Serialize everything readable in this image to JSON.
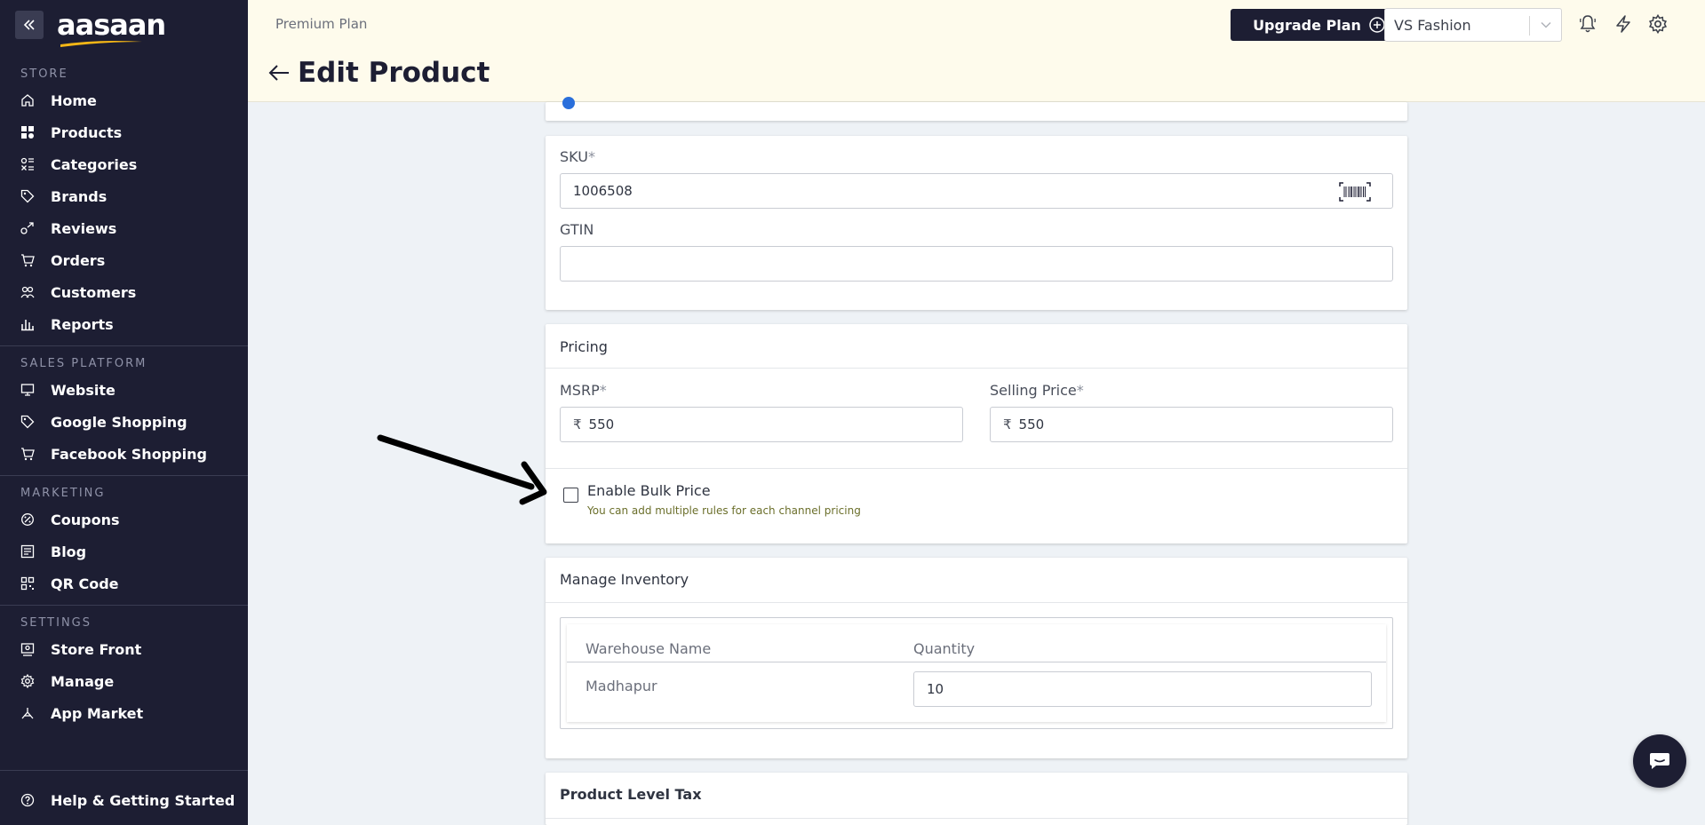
{
  "brand": {
    "logo_text": "aasaan"
  },
  "sidebar": {
    "sections": {
      "store": "STORE",
      "sales": "SALES PLATFORM",
      "marketing": "MARKETING",
      "settings": "SETTINGS"
    },
    "store_items": [
      "Home",
      "Products",
      "Categories",
      "Brands",
      "Reviews",
      "Orders",
      "Customers",
      "Reports"
    ],
    "sales_items": [
      "Website",
      "Google Shopping",
      "Facebook Shopping"
    ],
    "marketing_items": [
      "Coupons",
      "Blog",
      "QR Code"
    ],
    "settings_items": [
      "Store Front",
      "Manage",
      "App Market"
    ],
    "help": "Help & Getting Started"
  },
  "header": {
    "plan": "Premium Plan",
    "upgrade_label": "Upgrade Plan",
    "store_name": "VS Fashion",
    "page_title": "Edit Product"
  },
  "sku_card": {
    "sku_label": "SKU",
    "sku_value": "1006508",
    "gtin_label": "GTIN",
    "gtin_value": ""
  },
  "pricing_card": {
    "title": "Pricing",
    "msrp_label": "MSRP",
    "msrp_value": "550",
    "selling_label": "Selling Price",
    "selling_value": "550",
    "currency": "₹",
    "bulk_label": "Enable Bulk Price",
    "bulk_hint": "You can add multiple rules for each channel pricing"
  },
  "inventory_card": {
    "title": "Manage Inventory",
    "col_warehouse": "Warehouse Name",
    "col_quantity": "Quantity",
    "rows": [
      {
        "warehouse": "Madhapur",
        "quantity": "10"
      }
    ]
  },
  "tax_card": {
    "title": "Product Level Tax"
  },
  "colors": {
    "sidebar_bg": "#1d1e33",
    "header_bg": "#fefbec",
    "page_bg": "#eef2f6"
  }
}
